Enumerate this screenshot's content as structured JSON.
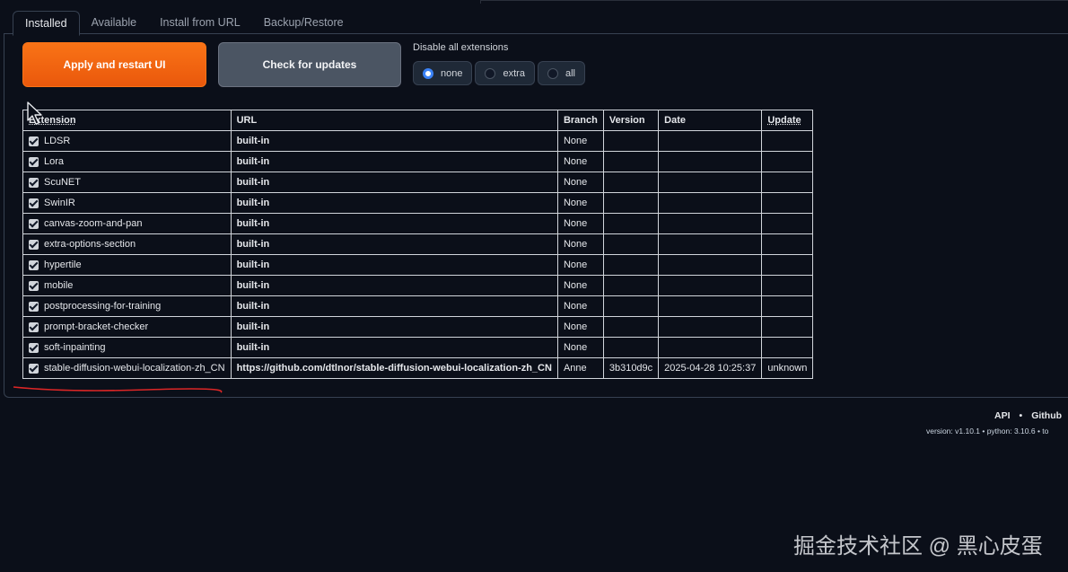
{
  "tabs": [
    "Installed",
    "Available",
    "Install from URL",
    "Backup/Restore"
  ],
  "buttons": {
    "apply": "Apply and restart UI",
    "check": "Check for updates"
  },
  "disable": {
    "title": "Disable all extensions",
    "options": [
      "none",
      "extra",
      "all"
    ],
    "selected": "none"
  },
  "table": {
    "headers": [
      "Extension",
      "URL",
      "Branch",
      "Version",
      "Date",
      "Update"
    ],
    "rows": [
      {
        "name": "LDSR",
        "url": "built-in",
        "branch": "None",
        "version": "",
        "date": "",
        "update": "",
        "checked": true
      },
      {
        "name": "Lora",
        "url": "built-in",
        "branch": "None",
        "version": "",
        "date": "",
        "update": "",
        "checked": true
      },
      {
        "name": "ScuNET",
        "url": "built-in",
        "branch": "None",
        "version": "",
        "date": "",
        "update": "",
        "checked": true
      },
      {
        "name": "SwinIR",
        "url": "built-in",
        "branch": "None",
        "version": "",
        "date": "",
        "update": "",
        "checked": true
      },
      {
        "name": "canvas-zoom-and-pan",
        "url": "built-in",
        "branch": "None",
        "version": "",
        "date": "",
        "update": "",
        "checked": true
      },
      {
        "name": "extra-options-section",
        "url": "built-in",
        "branch": "None",
        "version": "",
        "date": "",
        "update": "",
        "checked": true
      },
      {
        "name": "hypertile",
        "url": "built-in",
        "branch": "None",
        "version": "",
        "date": "",
        "update": "",
        "checked": true
      },
      {
        "name": "mobile",
        "url": "built-in",
        "branch": "None",
        "version": "",
        "date": "",
        "update": "",
        "checked": true
      },
      {
        "name": "postprocessing-for-training",
        "url": "built-in",
        "branch": "None",
        "version": "",
        "date": "",
        "update": "",
        "checked": true
      },
      {
        "name": "prompt-bracket-checker",
        "url": "built-in",
        "branch": "None",
        "version": "",
        "date": "",
        "update": "",
        "checked": true
      },
      {
        "name": "soft-inpainting",
        "url": "built-in",
        "branch": "None",
        "version": "",
        "date": "",
        "update": "",
        "checked": true
      },
      {
        "name": "stable-diffusion-webui-localization-zh_CN",
        "url": "https://github.com/dtlnor/stable-diffusion-webui-localization-zh_CN",
        "branch": "Anne",
        "version": "3b310d9c",
        "date": "2025-04-28 10:25:37",
        "update": "unknown",
        "checked": true
      }
    ]
  },
  "footer": {
    "links": [
      "API",
      "•",
      "Github"
    ],
    "version": "version: v1.10.1  •  python: 3.10.6  •  to"
  },
  "watermark": "掘金技术社区 @ 黑心皮蛋",
  "colors": {
    "background": "#0b0f19",
    "apply": "#f97316",
    "check": "#4b5563",
    "radio_on": "#3b82f6",
    "annotation": "#dc2626"
  }
}
